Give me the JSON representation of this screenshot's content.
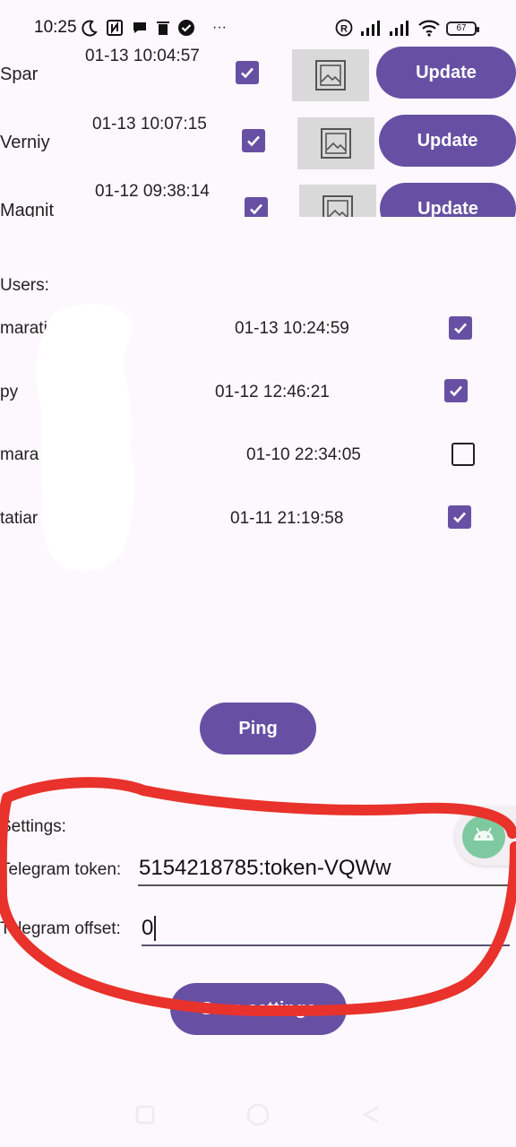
{
  "status_bar": {
    "time": "10:25",
    "battery": "67",
    "more": "···",
    "r_badge": "R"
  },
  "stores": [
    {
      "name": "Spar",
      "time": "01-13 10:04:57",
      "checked": true,
      "button": "Update"
    },
    {
      "name": "Verniy",
      "time": "01-13 10:07:15",
      "checked": true,
      "button": "Update"
    },
    {
      "name": "Magnit",
      "time": "01-12 09:38:14",
      "checked": true,
      "button": "Update"
    }
  ],
  "users_label": "Users:",
  "users": [
    {
      "name": "maratic",
      "time": "01-13 10:24:59",
      "checked": true
    },
    {
      "name": "py",
      "time": "01-12 12:46:21",
      "checked": true
    },
    {
      "name": "mara",
      "time": "01-10 22:34:05",
      "checked": false
    },
    {
      "name": "tatiar",
      "time": "01-11 21:19:58",
      "checked": true
    }
  ],
  "ping_button": "Ping",
  "settings": {
    "label": "Settings:",
    "token_label": "Telegram token:",
    "token_value": "5154218785:token-VQWw",
    "offset_label": "Telegram offset:",
    "offset_value": "0",
    "save_button": "Save settings"
  },
  "colors": {
    "accent": "#6750a4",
    "annotation": "#e8322b",
    "background": "#fdf8fd"
  }
}
